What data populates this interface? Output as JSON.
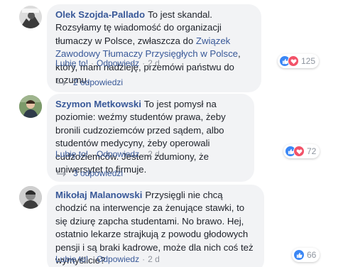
{
  "comments": [
    {
      "author": "Olek Szojda-Pallado",
      "text_before": "To jest skandal. Rozsyłamy tę wiadomość do organizacji tłumaczy w Polsce, zwłaszcza do ",
      "link_text": "Związek Zawodowy Tłumaczy Przysięgłych w Polsce",
      "text_after": ", który, mam nadzieję, przemówi państwu do rozumu.",
      "reaction_count": "125",
      "reactions": [
        "like-icon",
        "love-icon"
      ],
      "like_label": "Lubię to!",
      "reply_label": "Odpowiedz",
      "time": "2 d",
      "replies_label": "2 odpowiedzi"
    },
    {
      "author": "Szymon Metkowski",
      "text": "To jest pomysł na poziomie: weźmy studentów prawa, żeby bronili cudzoziemców przed sądem, albo studentów medycyny, żeby operowali cudzoziemców. Jestem zdumiony, że uniwersytet to firmuje.",
      "reaction_count": "72",
      "reactions": [
        "like-icon",
        "love-icon"
      ],
      "like_label": "Lubię to!",
      "reply_label": "Odpowiedz",
      "time": "2 d",
      "replies_label": "3 odpowiedzi"
    },
    {
      "author": "Mikołaj Malanowski",
      "text": "Przysięgli nie chcą chodzić na interwencje za żenujące stawki, to się dziurę zapcha studentami. No brawo. Hej, ostatnio lekarze strajkują z powodu głodowych pensji i są braki kadrowe, może dla nich coś też wymyślicie?",
      "reaction_count": "66",
      "reactions": [
        "like-icon"
      ],
      "like_label": "Lubię to!",
      "reply_label": "Odpowiedz",
      "time": "2 d"
    }
  ],
  "separator": "·",
  "colors": {
    "link": "#385898",
    "bubble": "#f2f3f5",
    "like": "#3b87f5",
    "love": "#f25268",
    "meta": "#90949c"
  }
}
